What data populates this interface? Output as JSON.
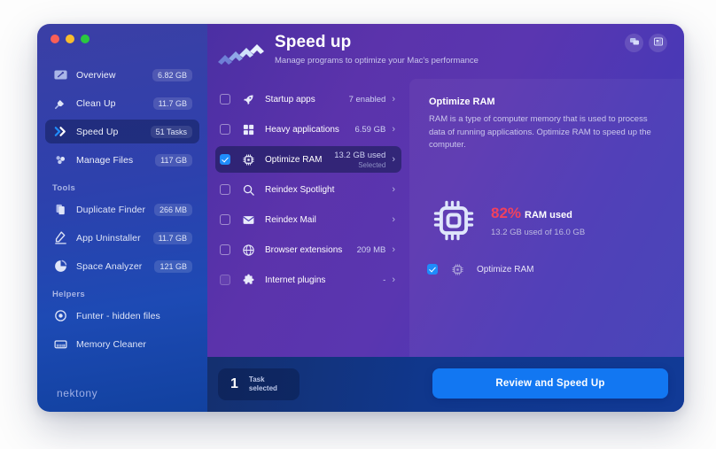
{
  "window": {
    "traffic_lights": [
      "close",
      "minimize",
      "zoom"
    ],
    "brand": "nektony"
  },
  "sidebar": {
    "items": [
      {
        "label": "Overview",
        "badge": "6.82 GB",
        "icon": "overview-icon",
        "active": false
      },
      {
        "label": "Clean Up",
        "badge": "11.7 GB",
        "icon": "broom-icon",
        "active": false
      },
      {
        "label": "Speed Up",
        "badge": "51 Tasks",
        "icon": "double-chevron-icon",
        "active": true
      },
      {
        "label": "Manage Files",
        "badge": "117 GB",
        "icon": "files-icon",
        "active": false
      }
    ],
    "tools_header": "Tools",
    "tools": [
      {
        "label": "Duplicate Finder",
        "badge": "266 MB",
        "icon": "duplicate-icon"
      },
      {
        "label": "App Uninstaller",
        "badge": "11.7 GB",
        "icon": "uninstaller-icon"
      },
      {
        "label": "Space Analyzer",
        "badge": "121 GB",
        "icon": "pie-chart-icon"
      }
    ],
    "helpers_header": "Helpers",
    "helpers": [
      {
        "label": "Funter - hidden files",
        "badge": "",
        "icon": "target-icon"
      },
      {
        "label": "Memory Cleaner",
        "badge": "",
        "icon": "memory-icon"
      }
    ]
  },
  "header": {
    "title": "Speed up",
    "subtitle": "Manage programs to optimize your Mac's performance",
    "icon": "speed-arrows-icon",
    "buttons": [
      {
        "name": "chat-icon"
      },
      {
        "name": "news-icon"
      }
    ]
  },
  "tasks": [
    {
      "label": "Startup apps",
      "value": "7 enabled",
      "sub": "",
      "icon": "rocket-icon",
      "checked": false,
      "selected": false,
      "dim": false
    },
    {
      "label": "Heavy applications",
      "value": "6.59 GB",
      "sub": "",
      "icon": "grid-icon",
      "checked": false,
      "selected": false,
      "dim": false
    },
    {
      "label": "Optimize RAM",
      "value": "13.2 GB used",
      "sub": "Selected",
      "icon": "chip-icon",
      "checked": true,
      "selected": true,
      "dim": false
    },
    {
      "label": "Reindex Spotlight",
      "value": "",
      "sub": "",
      "icon": "search-icon",
      "checked": false,
      "selected": false,
      "dim": false
    },
    {
      "label": "Reindex Mail",
      "value": "",
      "sub": "",
      "icon": "mail-icon",
      "checked": false,
      "selected": false,
      "dim": false
    },
    {
      "label": "Browser extensions",
      "value": "209 MB",
      "sub": "",
      "icon": "globe-icon",
      "checked": false,
      "selected": false,
      "dim": false
    },
    {
      "label": "Internet plugins",
      "value": "-",
      "sub": "",
      "icon": "puzzle-icon",
      "checked": false,
      "selected": false,
      "dim": true
    }
  ],
  "detail": {
    "title": "Optimize RAM",
    "description": "RAM is a type of computer memory that is used to process data of running applications. Optimize RAM to speed up the computer.",
    "ram_percent": "82%",
    "ram_used_label": "RAM used",
    "ram_detail": "13.2 GB used of 16.0 GB",
    "checkbox_label": "Optimize RAM",
    "checkbox_checked": true,
    "percent_color": "#f2415e"
  },
  "footer": {
    "count": "1",
    "count_label_line1": "Task",
    "count_label_line2": "selected",
    "cta_label": "Review and Speed Up",
    "cta_color": "#1277f2"
  }
}
